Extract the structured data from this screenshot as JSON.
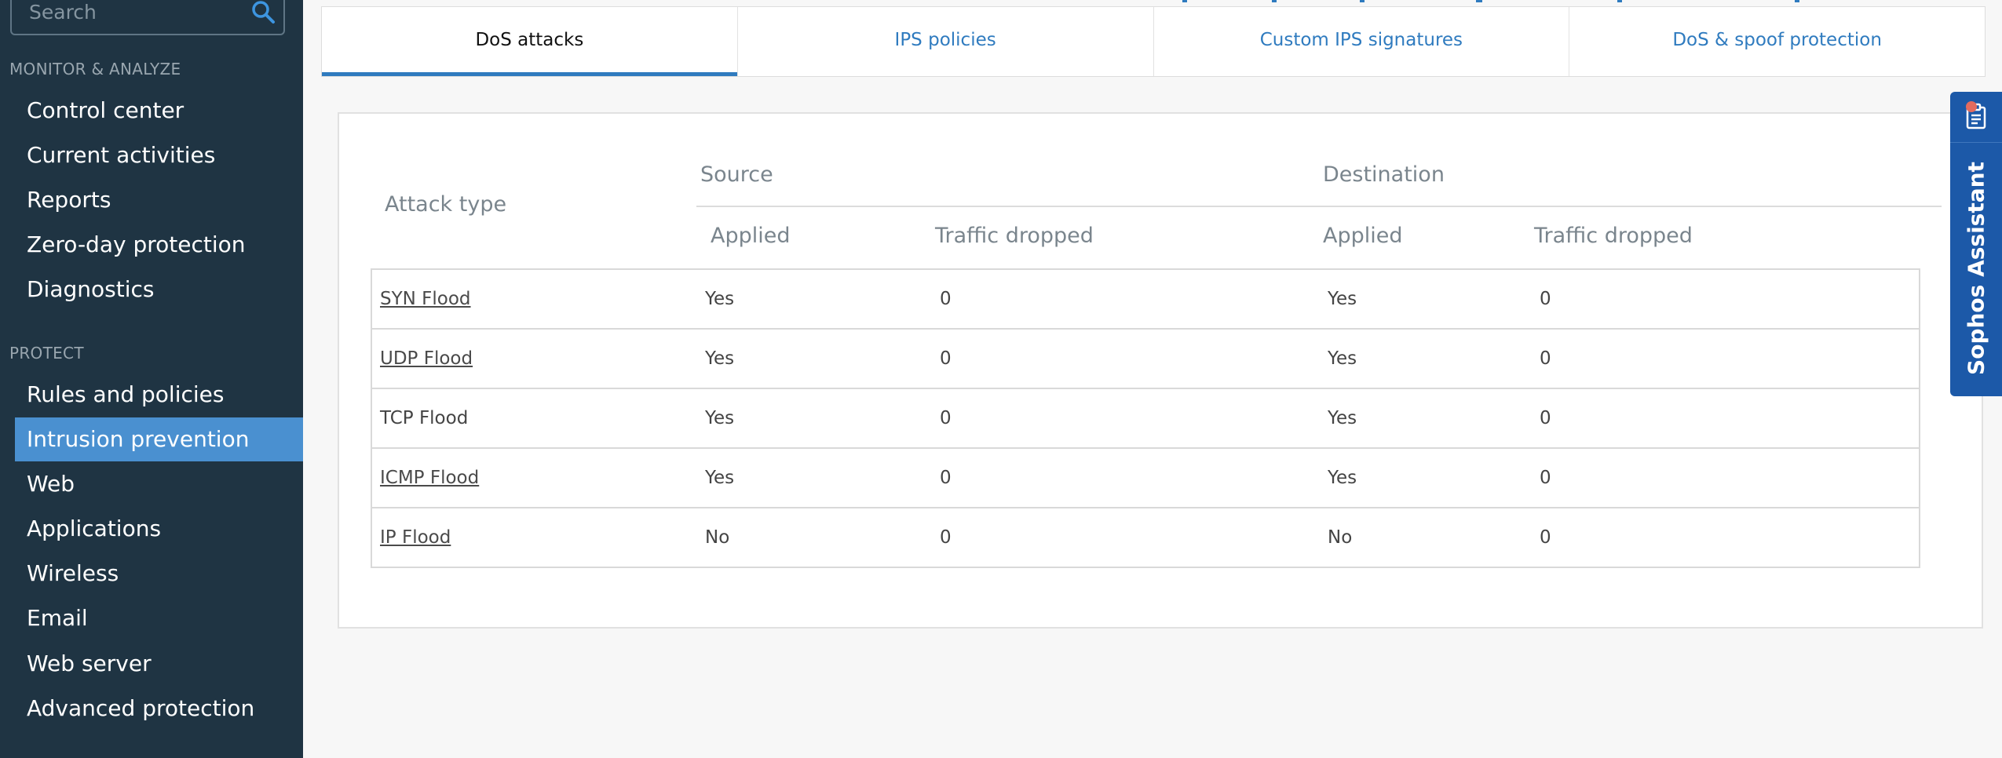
{
  "sidebar": {
    "search_placeholder": "Search",
    "sections": [
      {
        "title": "MONITOR & ANALYZE",
        "items": [
          "Control center",
          "Current activities",
          "Reports",
          "Zero-day protection",
          "Diagnostics"
        ]
      },
      {
        "title": "PROTECT",
        "items": [
          "Rules and policies",
          "Intrusion prevention",
          "Web",
          "Applications",
          "Wireless",
          "Email",
          "Web server",
          "Advanced protection"
        ]
      }
    ],
    "active_item": "Intrusion prevention"
  },
  "tabs": [
    "DoS attacks",
    "IPS policies",
    "Custom IPS signatures",
    "DoS & spoof protection"
  ],
  "active_tab": "DoS attacks",
  "table": {
    "headers": {
      "attack_type": "Attack type",
      "source": "Source",
      "destination": "Destination",
      "applied": "Applied",
      "traffic_dropped": "Traffic dropped"
    },
    "rows": [
      {
        "attack": "SYN Flood",
        "link": true,
        "src_applied": "Yes",
        "src_dropped": "0",
        "dst_applied": "Yes",
        "dst_dropped": "0"
      },
      {
        "attack": "UDP Flood",
        "link": true,
        "src_applied": "Yes",
        "src_dropped": "0",
        "dst_applied": "Yes",
        "dst_dropped": "0"
      },
      {
        "attack": "TCP Flood",
        "link": false,
        "src_applied": "Yes",
        "src_dropped": "0",
        "dst_applied": "Yes",
        "dst_dropped": "0"
      },
      {
        "attack": "ICMP Flood",
        "link": true,
        "src_applied": "Yes",
        "src_dropped": "0",
        "dst_applied": "Yes",
        "dst_dropped": "0"
      },
      {
        "attack": "IP Flood",
        "link": true,
        "src_applied": "No",
        "src_dropped": "0",
        "dst_applied": "No",
        "dst_dropped": "0"
      }
    ]
  },
  "assistant": {
    "label": "Sophos Assistant",
    "icon": "clipboard-icon"
  },
  "colors": {
    "sidebar_bg": "#1f3443",
    "active_nav": "#4a90d0",
    "tab_link": "#2f7bbf",
    "assistant_bg": "#1c59a8"
  }
}
